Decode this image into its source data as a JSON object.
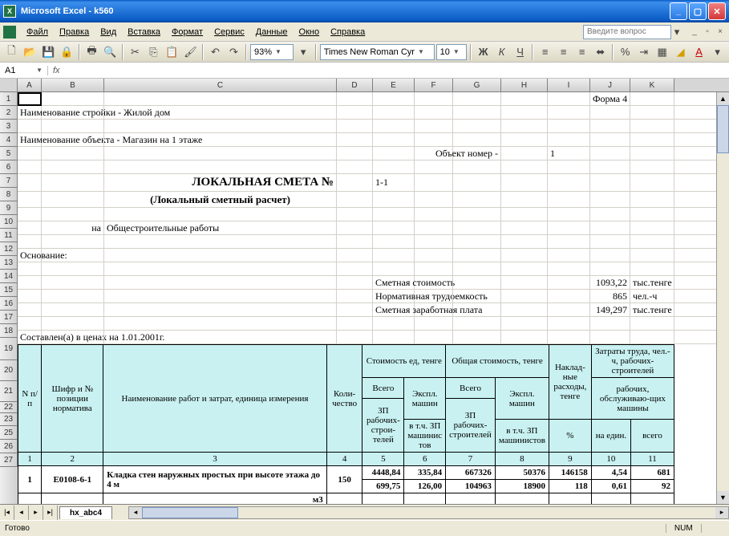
{
  "window": {
    "title": "Microsoft Excel - k560"
  },
  "menu": {
    "items": [
      "Файл",
      "Правка",
      "Вид",
      "Вставка",
      "Формат",
      "Сервис",
      "Данные",
      "Окно",
      "Справка"
    ],
    "help_placeholder": "Введите вопрос"
  },
  "toolbar": {
    "zoom": "93%",
    "font": "Times New Roman Cyr",
    "size": "10"
  },
  "namebox": {
    "ref": "A1"
  },
  "columns": [
    "A",
    "B",
    "C",
    "D",
    "E",
    "F",
    "G",
    "H",
    "I",
    "J",
    "K"
  ],
  "rows_before_table": [
    "1",
    "2",
    "3",
    "4",
    "5",
    "6",
    "7",
    "8",
    "9",
    "10",
    "11",
    "12",
    "13",
    "14",
    "15",
    "16",
    "17",
    "18"
  ],
  "table_header_rows": [
    "19",
    "20",
    "21",
    "22",
    "23"
  ],
  "data_rows": [
    "25",
    "26",
    "27"
  ],
  "doc": {
    "form": "Форма 4",
    "stroika_label": "Наименование стройки - Жилой дом",
    "objekt_label": "Наименование объекта - Магазин на 1 этаже",
    "obj_num_label": "Объект номер -",
    "obj_num": "1",
    "title": "ЛОКАЛЬНАЯ СМЕТА    №",
    "smeta_num": "1-1",
    "subtitle": "(Локальный сметный расчет)",
    "works_na": "на",
    "works": "Общестроительные работы",
    "basis": "Основание:",
    "cost_label": "Сметная стоимость",
    "cost_val": "1093,22",
    "cost_unit": "тыс.тенге",
    "labor_label": "Нормативная трудоемкость",
    "labor_val": "865",
    "labor_unit": "чел.-ч",
    "wage_label": "Сметная заработная плата",
    "wage_val": "149,297",
    "wage_unit": "тыс.тенге",
    "compiled": "Составлен(а) в ценах на 1.01.2001г."
  },
  "thead": {
    "c1": "N п/п",
    "c2": "Шифр и № позиции норматива",
    "c3": "Наименование работ и затрат,  единица измерения",
    "c4": "Коли- чество",
    "g5": "Стоимость ед, тенге",
    "g6": "Общая стоимость, тенге",
    "g7": "Наклад- ные расходы, тенге",
    "g8": "Затраты  труда, чел.-ч, рабочих-строителей",
    "c5a": "Всего",
    "c5b": "ЗП рабочих- строи- телей",
    "c6a": "Экспл. машин",
    "c6b": "в т.ч. ЗП машинис тов",
    "c7a": "Всего",
    "c7b": "ЗП рабочих- строителей",
    "c8a": "Экспл. машин",
    "c8b": "в т.ч. ЗП машинистов",
    "c9b": "%",
    "c10a": "рабочих, обслуживаю-щих машины",
    "c10b": "на един.",
    "c11b": "всего",
    "n1": "1",
    "n2": "2",
    "n3": "3",
    "n4": "4",
    "n5": "5",
    "n6": "6",
    "n7": "7",
    "n8": "8",
    "n9": "9",
    "n10": "10",
    "n11": "11"
  },
  "row1": {
    "n": "1",
    "code": "Е0108-6-1",
    "name": "Кладка стен наружных простых при высоте этажа до 4 м",
    "unit": "м3",
    "qty": "150",
    "c5": "4448,84",
    "c6": "335,84",
    "c7": "667326",
    "c8": "50376",
    "c9": "146158",
    "c10": "4,54",
    "c11": "681",
    "c5b": "699,75",
    "c6b": "126,00",
    "c7b": "104963",
    "c8b": "18900",
    "c9b": "118",
    "c10b": "0,61",
    "c11b": "92"
  },
  "sheet_tab": "hx_abc4",
  "status": {
    "ready": "Готово",
    "num": "NUM"
  }
}
